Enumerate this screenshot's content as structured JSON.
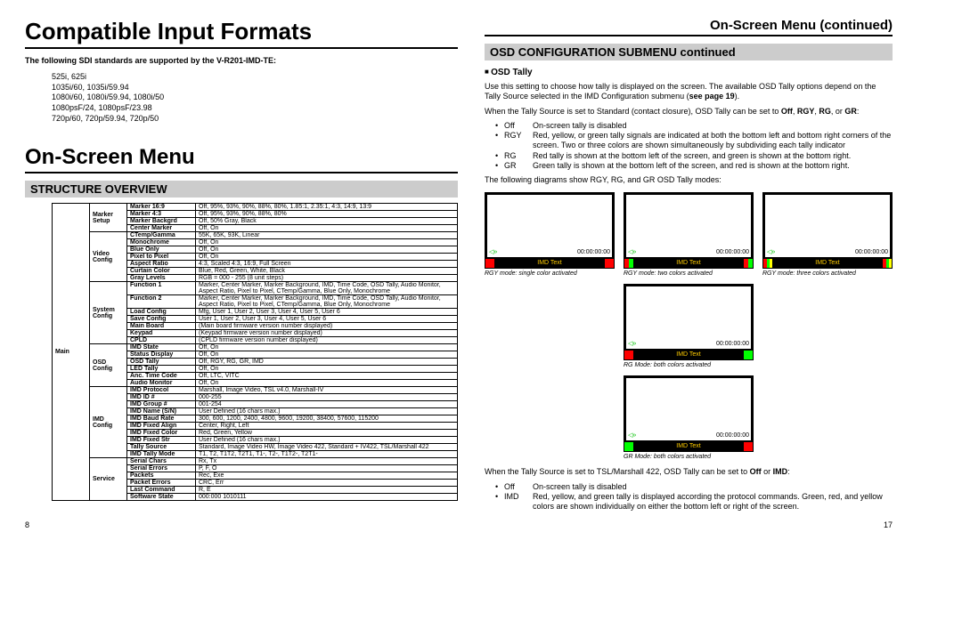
{
  "left": {
    "h1a": "Compatible Input Formats",
    "intro": "The following SDI standards are supported by the V-R201-IMD-TE:",
    "formats": [
      "525i, 625i",
      "1035i/60, 1035i/59.94",
      "1080i/60, 1080i/59.94, 1080i/50",
      "1080psF/24, 1080psF/23.98",
      "720p/60, 720p/59.94, 720p/50"
    ],
    "h1b": "On-Screen Menu",
    "h2": "STRUCTURE OVERVIEW",
    "main_label": "Main",
    "groups": [
      {
        "cat": "Marker Setup",
        "rows": [
          [
            "Marker 16:9",
            "Off, 95%, 93%, 90%, 88%, 80%, 1.85:1, 2.35:1, 4:3, 14:9, 13:9"
          ],
          [
            "Marker 4:3",
            "Off, 95%, 93%, 90%, 88%, 80%"
          ],
          [
            "Marker Backgrd",
            "Off, 50% Gray, Black"
          ],
          [
            "Center Marker",
            "Off, On"
          ]
        ]
      },
      {
        "cat": "Video Config",
        "rows": [
          [
            "CTemp/Gamma",
            "55K, 65K, 93K, Linear"
          ],
          [
            "Monochrome",
            "Off, On"
          ],
          [
            "Blue Only",
            "Off, On"
          ],
          [
            "Pixel to Pixel",
            "Off, On"
          ],
          [
            "Aspect Ratio",
            "4:3, Scaled 4:3, 16:9, Full Screen"
          ],
          [
            "Curtain Color",
            "Blue, Red, Green, White, Black"
          ],
          [
            "Gray Levels",
            "RGB = 000 - 255 (8 unit steps)"
          ]
        ]
      },
      {
        "cat": "System Config",
        "rows": [
          [
            "Function 1",
            "Marker, Center Marker, Marker Background, IMD, Time Code, OSD Tally, Audio Monitor, Aspect Ratio, Pixel to Pixel, CTemp/Gamma, Blue Only, Monochrome"
          ],
          [
            "Function 2",
            "Marker, Center Marker, Marker Background, IMD, Time Code, OSD Tally, Audio Monitor, Aspect Ratio, Pixel to Pixel, CTemp/Gamma, Blue Only, Monochrome"
          ],
          [
            "Load Config",
            "Mfg, User 1, User 2, User 3, User 4, User 5, User 6"
          ],
          [
            "Save Config",
            "User 1, User 2, User 3, User 4, User 5, User 6"
          ],
          [
            "Main Board",
            "(Main board firmware version number displayed)"
          ],
          [
            "Keypad",
            "(Keypad firmware version number displayed)"
          ],
          [
            "CPLD",
            "(CPLD firmware version number displayed)"
          ]
        ]
      },
      {
        "cat": "OSD Config",
        "rows": [
          [
            "IMD State",
            "Off, On"
          ],
          [
            "Status Display",
            "Off, On"
          ],
          [
            "OSD Tally",
            "Off, RGY, RG, GR, IMD"
          ],
          [
            "LED Tally",
            "Off, On"
          ],
          [
            "Anc. Time Code",
            "Off, LTC, VITC"
          ],
          [
            "Audio Monitor",
            "Off, On"
          ]
        ]
      },
      {
        "cat": "IMD Config",
        "rows": [
          [
            "IMD Protocol",
            "Marshall, Image Video, TSL v4.0, Marshall-IV"
          ],
          [
            "IMD ID #",
            "000-255"
          ],
          [
            "IMD Group #",
            "001-254"
          ],
          [
            "IMD Name (S/N)",
            "User Defined (16 chars max.)"
          ],
          [
            "IMD Baud Rate",
            "300, 600, 1200, 2400, 4800, 9600, 19200, 38400, 57600, 115200"
          ],
          [
            "IMD Fixed Align",
            "Center, Right, Left"
          ],
          [
            "IMD Fixed Color",
            "Red, Green, Yellow"
          ],
          [
            "IMD Fixed Str",
            "User Defined (16 chars max.)"
          ],
          [
            "Tally Source",
            "Standard, Image Video HW, Image Video 422, Standard + IV422, TSL/Marshall 422"
          ],
          [
            "IMD Tally Mode",
            "T1, T2, T1T2, T2T1, T1-, T2-, T1T2-, T2T1-"
          ]
        ]
      },
      {
        "cat": "Service",
        "rows": [
          [
            "Serial Chars",
            "Rx, Tx"
          ],
          [
            "Serial Errors",
            "P, F, O"
          ],
          [
            "Packets",
            "Rec, Exe"
          ],
          [
            "Packet Errors",
            "CRC, Err"
          ],
          [
            "Last Command",
            "R, E"
          ],
          [
            "Software State",
            "000:000 1010111"
          ]
        ]
      }
    ],
    "page_num": "8"
  },
  "right": {
    "title": "On-Screen Menu (continued)",
    "h2": "OSD CONFIGURATION SUBMENU continued",
    "sub": "OSD Tally",
    "p1a": "Use this setting to choose how tally is displayed on the screen.  The available OSD Tally options depend on the Tally Source selected in the IMD Configuration submenu (",
    "p1b": "see page 19",
    "p1c": ").",
    "p2a": "When the Tally Source is set to Standard (contact closure), OSD Tally can be set to ",
    "p2b": "Off",
    "p2c": ", ",
    "p2d": "RGY",
    "p2e": ", ",
    "p2f": "RG",
    "p2g": ", or ",
    "p2h": "GR",
    "p2i": ":",
    "opts1": [
      {
        "code": "Off",
        "text": "On-screen tally is disabled"
      },
      {
        "code": "RGY",
        "text": "Red, yellow, or green tally signals are indicated at both the bottom left and bottom right corners of the screen. Two or three colors are shown simultaneously by subdividing each tally indicator"
      },
      {
        "code": "RG",
        "text": "Red tally is shown at the bottom left of the screen, and green is shown at the bottom right."
      },
      {
        "code": "GR",
        "text": "Green tally is shown at the bottom left of the screen, and red is shown at the bottom right."
      }
    ],
    "p3": "The following diagrams show RGY, RG, and GR OSD Tally modes:",
    "imd_text": "IMD Text",
    "tc": "00:00:00:00",
    "captions": [
      "RGY mode: single color activated",
      "RGY mode: two colors activated",
      "RGY mode: three colors activated",
      "RG Mode: both colors activated",
      "GR Mode: both colors activated"
    ],
    "p4a": "When the Tally Source is set to TSL/Marshall 422, OSD Tally can be set to ",
    "p4b": "Off",
    "p4c": " or ",
    "p4d": "IMD",
    "p4e": ":",
    "opts2": [
      {
        "code": "Off",
        "text": "On-screen tally is disabled"
      },
      {
        "code": "IMD",
        "text": "Red, yellow, and green tally is displayed according the protocol commands. Green, red, and yellow colors are shown individually on either the bottom left or right of the screen."
      }
    ],
    "page_num": "17"
  }
}
